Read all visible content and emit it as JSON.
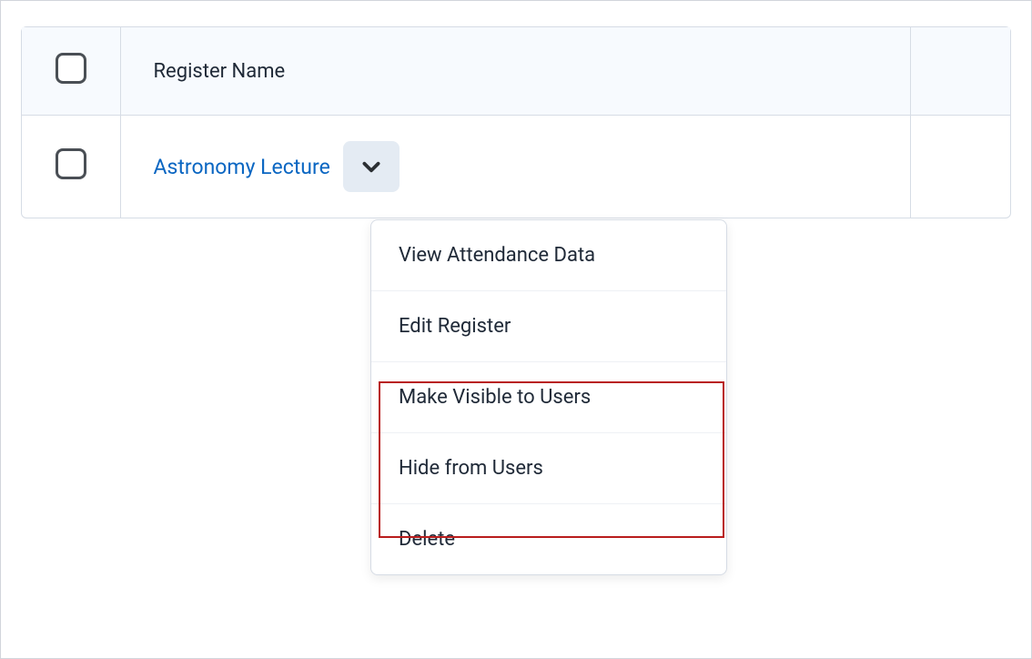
{
  "table": {
    "header": {
      "name_label": "Register Name"
    },
    "rows": [
      {
        "name": "Astronomy Lecture"
      }
    ]
  },
  "dropdown": {
    "items": [
      {
        "label": "View Attendance Data"
      },
      {
        "label": "Edit Register"
      },
      {
        "label": "Make Visible to Users"
      },
      {
        "label": "Hide from Users"
      },
      {
        "label": "Delete"
      }
    ]
  }
}
